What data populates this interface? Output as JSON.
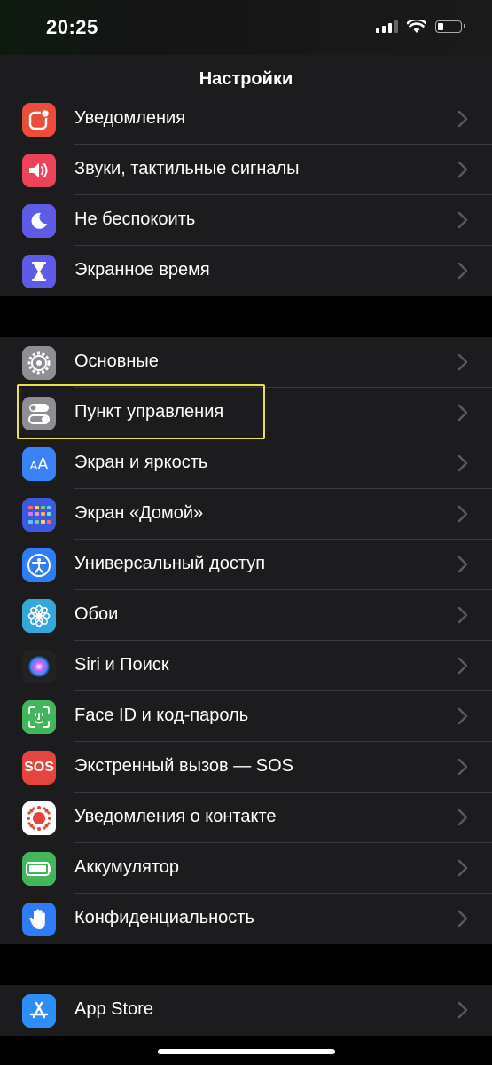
{
  "status_bar": {
    "time": "20:25",
    "battery_level": 0.25
  },
  "nav": {
    "title": "Настройки"
  },
  "groups": [
    {
      "items": [
        {
          "label": "Уведомления",
          "icon": "notifications-icon",
          "color": "#eb4d3d"
        },
        {
          "label": "Звуки, тактильные сигналы",
          "icon": "sounds-icon",
          "color": "#eb445a"
        },
        {
          "label": "Не беспокоить",
          "icon": "moon-icon",
          "color": "#5e5ce6"
        },
        {
          "label": "Экранное время",
          "icon": "hourglass-icon",
          "color": "#5e5ce6"
        }
      ]
    },
    {
      "items": [
        {
          "label": "Основные",
          "icon": "gear-icon",
          "color": "#8e8e93"
        },
        {
          "label": "Пункт управления",
          "icon": "toggles-icon",
          "color": "#8e8e93",
          "highlighted": true
        },
        {
          "label": "Экран и яркость",
          "icon": "text-size-icon",
          "text": "AA",
          "color": "#3a82f6"
        },
        {
          "label": "Экран «Домой»",
          "icon": "home-screen-grid-icon",
          "color": "#3a5be0"
        },
        {
          "label": "Универсальный доступ",
          "icon": "accessibility-icon",
          "color": "#2f7cf6"
        },
        {
          "label": "Обои",
          "icon": "wallpaper-flower-icon",
          "color": "#36a7d9"
        },
        {
          "label": "Siri и Поиск",
          "icon": "siri-icon",
          "color": "#222222"
        },
        {
          "label": "Face ID и код-пароль",
          "icon": "face-id-icon",
          "color": "#43b65b"
        },
        {
          "label": "Экстренный вызов — SOS",
          "icon": "sos-icon",
          "text": "SOS",
          "color": "#e5453c"
        },
        {
          "label": "Уведомления о контакте",
          "icon": "exposure-notifications-icon",
          "color": "#ffffff"
        },
        {
          "label": "Аккумулятор",
          "icon": "battery-icon",
          "color": "#43b65b"
        },
        {
          "label": "Конфиденциальность",
          "icon": "hand-icon",
          "color": "#2f7cf6"
        }
      ]
    },
    {
      "items": [
        {
          "label": "App Store",
          "icon": "app-store-icon",
          "color": "#2f8df6"
        }
      ]
    }
  ]
}
